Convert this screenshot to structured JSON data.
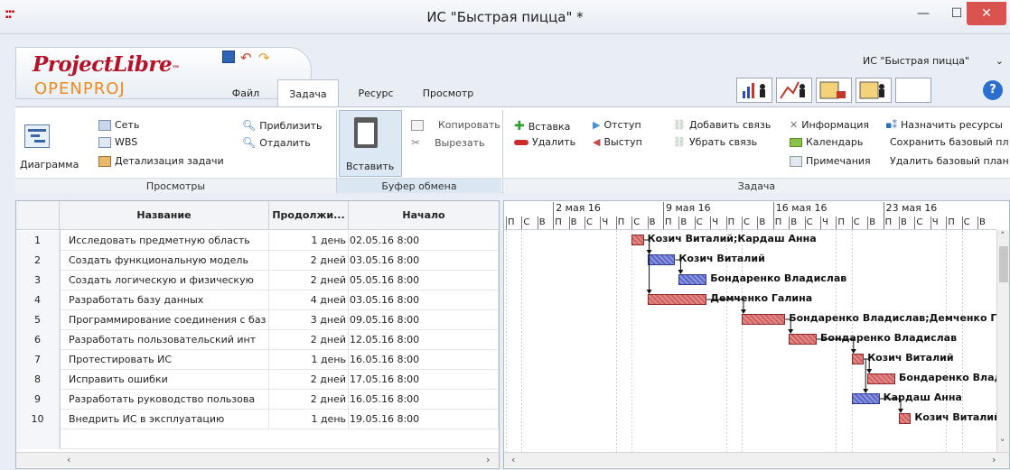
{
  "window": {
    "title": "ИС \"Быстрая пицца\" *",
    "min": "—",
    "max": "☐",
    "close": "✕"
  },
  "logo": {
    "projectlibre": "ProjectLibre",
    "tm": "™",
    "openproj": "OPENPROJ"
  },
  "quick": {
    "save": "save",
    "undo": "undo",
    "redo": "redo"
  },
  "tabs": [
    "Файл",
    "Задача",
    "Ресурс",
    "Просмотр"
  ],
  "project_select": {
    "value": "ИС \"Быстрая пицца\""
  },
  "help": "?",
  "ribbon": {
    "views": {
      "diagram": "Диаграмма",
      "network": "Сеть",
      "wbs": "WBS",
      "task_detail": "Детализация задачи",
      "zoom_in": "Приблизить",
      "zoom_out": "Отдалить",
      "label": "Просмотры"
    },
    "clipboard": {
      "paste": "Вставить",
      "copy": "Копировать",
      "cut": "Вырезать",
      "label": "Буфер обмена"
    },
    "task": {
      "insert": "Вставка",
      "delete": "Удалить",
      "indent": "Отступ",
      "outdent": "Выступ",
      "add_link": "Добавить связь",
      "remove_link": "Убрать связь",
      "info": "Информация",
      "calendar": "Календарь",
      "notes": "Примечания",
      "assign": "Назначить ресурсы",
      "save_baseline": "Сохранить базовый пл",
      "delete_baseline": "Удалить базовый план",
      "label": "Задача"
    }
  },
  "grid": {
    "headers": [
      "",
      "Название",
      "Продолжи...",
      "Начало"
    ],
    "rows": [
      {
        "id": "1",
        "name": "Исследовать предметную область",
        "dur": "1 день",
        "start": "02.05.16 8:00"
      },
      {
        "id": "2",
        "name": "Создать функциональную модель",
        "dur": "2 дней",
        "start": "03.05.16 8:00"
      },
      {
        "id": "3",
        "name": "Создать логическую и физическую",
        "dur": "2 дней",
        "start": "05.05.16 8:00"
      },
      {
        "id": "4",
        "name": "Разработать базу данных",
        "dur": "4 дней",
        "start": "03.05.16 8:00"
      },
      {
        "id": "5",
        "name": "Программирование соединения с баз",
        "dur": "3 дней",
        "start": "09.05.16 8:00"
      },
      {
        "id": "6",
        "name": "Разработать пользовательский инт",
        "dur": "2 дней",
        "start": "12.05.16 8:00"
      },
      {
        "id": "7",
        "name": "Протестировать ИС",
        "dur": "1 день",
        "start": "16.05.16 8:00"
      },
      {
        "id": "8",
        "name": "Исправить ошибки",
        "dur": "2 дней",
        "start": "17.05.16 8:00"
      },
      {
        "id": "9",
        "name": "Разработать руководство пользова",
        "dur": "2 дней",
        "start": "16.05.16 8:00"
      },
      {
        "id": "10",
        "name": "Внедрить ИС в эксплуатацию",
        "dur": "1 день",
        "start": "19.05.16 8:00"
      }
    ]
  },
  "gantt": {
    "weeks": [
      "2 мая 16",
      "9 мая 16",
      "16 мая 16",
      "23 мая 16"
    ],
    "days": [
      "П",
      "С",
      "В",
      "П",
      "В",
      "С",
      "Ч",
      "П",
      "С",
      "В",
      "П",
      "В",
      "С",
      "Ч",
      "П",
      "С",
      "В",
      "П",
      "В",
      "С",
      "Ч",
      "П",
      "С",
      "В",
      "П",
      "В",
      "С",
      "Ч",
      "П",
      "С",
      "В"
    ],
    "bars": [
      {
        "row": 0,
        "start": 8,
        "len": 1,
        "color": "red",
        "label": "Козич Виталий;Кардаш Анна"
      },
      {
        "row": 1,
        "start": 9,
        "len": 2,
        "color": "blue",
        "label": "Козич Виталий"
      },
      {
        "row": 2,
        "start": 11,
        "len": 2,
        "color": "blue",
        "label": "Бондаренко Владислав"
      },
      {
        "row": 3,
        "start": 9,
        "len": 4,
        "color": "red",
        "label": "Демченко Галина"
      },
      {
        "row": 4,
        "start": 15,
        "len": 3,
        "color": "red",
        "label": "Бондаренко Владислав;Демченко Галина"
      },
      {
        "row": 5,
        "start": 18,
        "len": 2,
        "color": "red",
        "label": "Бондаренко Владислав"
      },
      {
        "row": 6,
        "start": 22,
        "len": 1,
        "color": "red",
        "label": "Козич Виталий"
      },
      {
        "row": 7,
        "start": 23,
        "len": 2,
        "color": "red",
        "label": "Бондаренко Владислав"
      },
      {
        "row": 8,
        "start": 22,
        "len": 2,
        "color": "blue",
        "label": "Кардаш Анна"
      },
      {
        "row": 9,
        "start": 25,
        "len": 1,
        "color": "red",
        "label": "Козич Виталий"
      }
    ]
  }
}
